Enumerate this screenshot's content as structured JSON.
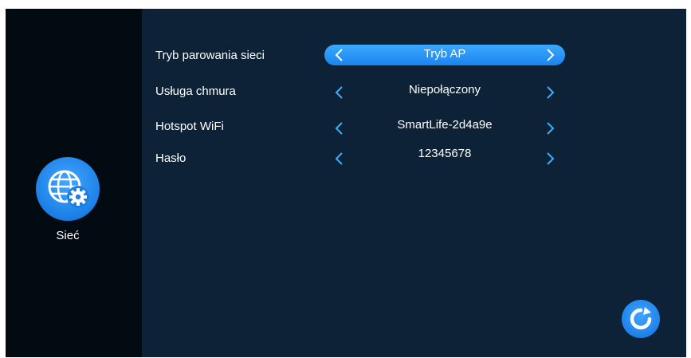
{
  "sidebar": {
    "icon": "globe-gear-icon",
    "label": "Sieć"
  },
  "settings": [
    {
      "label": "Tryb parowania sieci",
      "value": "Tryb AP",
      "active": true
    },
    {
      "label": "Usługa chmura",
      "value": "Niepołączony",
      "active": false
    },
    {
      "label": "Hotspot WiFi",
      "value": "SmartLife-2d4a9e",
      "active": false
    },
    {
      "label": "Hasło",
      "value": "12345678",
      "active": false
    }
  ],
  "actions": {
    "refresh_icon": "refresh-icon"
  },
  "colors": {
    "background": "#0d2236",
    "sidebar": "#020b12",
    "accent": "#2596ff",
    "arrow": "#3ab0ff",
    "text": "#ffffff"
  }
}
